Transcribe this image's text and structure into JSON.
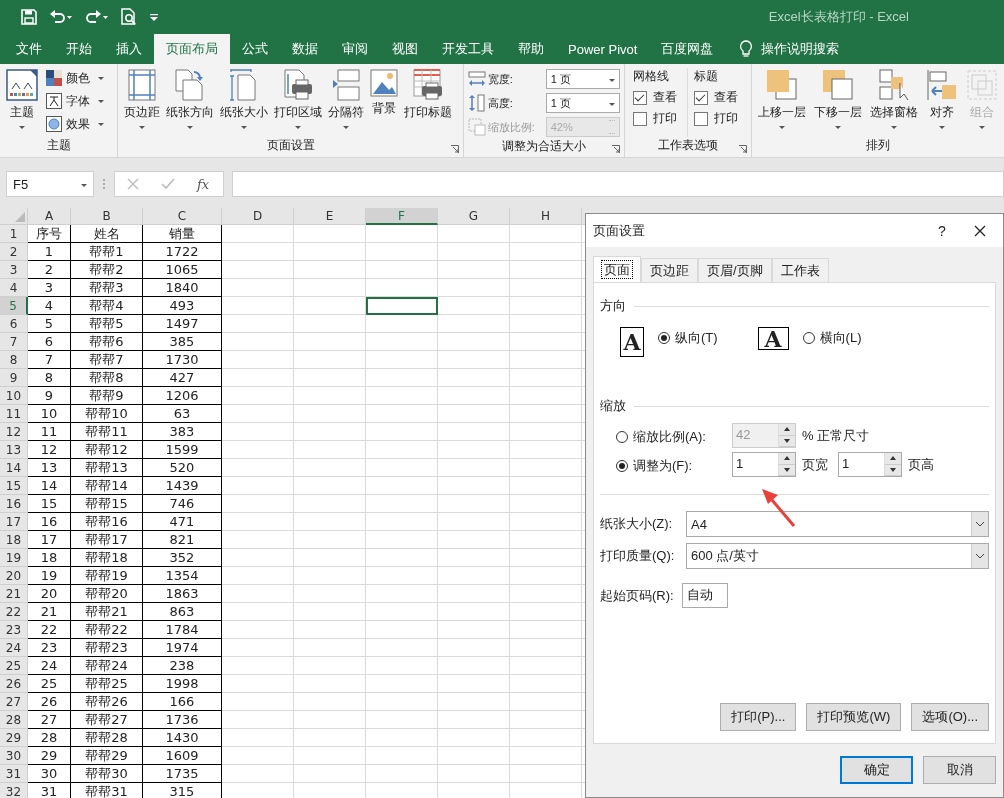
{
  "window": {
    "title": "Excel长表格打印  -  Excel"
  },
  "ribbon_tabs": [
    {
      "label": "文件",
      "selected": false
    },
    {
      "label": "开始",
      "selected": false
    },
    {
      "label": "插入",
      "selected": false
    },
    {
      "label": "页面布局",
      "selected": true
    },
    {
      "label": "公式",
      "selected": false
    },
    {
      "label": "数据",
      "selected": false
    },
    {
      "label": "审阅",
      "selected": false
    },
    {
      "label": "视图",
      "selected": false
    },
    {
      "label": "开发工具",
      "selected": false
    },
    {
      "label": "帮助",
      "selected": false
    },
    {
      "label": "Power Pivot",
      "selected": false
    },
    {
      "label": "百度网盘",
      "selected": false
    }
  ],
  "tell_me": "操作说明搜索",
  "ribbon": {
    "themes": {
      "label": "主题",
      "button": "主题",
      "items": [
        "颜色",
        "字体",
        "效果"
      ]
    },
    "page_setup": {
      "label": "页面设置",
      "buttons": [
        {
          "label": "页边距",
          "kind": "margins"
        },
        {
          "label": "纸张方向",
          "kind": "orientation"
        },
        {
          "label": "纸张大小",
          "kind": "size"
        },
        {
          "label": "打印区域",
          "kind": "area"
        },
        {
          "label": "分隔符",
          "kind": "breaks"
        },
        {
          "label": "背景",
          "kind": "background"
        },
        {
          "label": "打印标题",
          "kind": "titles"
        }
      ]
    },
    "scale_to_fit": {
      "label": "调整为合适大小",
      "fields": [
        {
          "label": "宽度:",
          "value": "1 页",
          "disabled": false
        },
        {
          "label": "高度:",
          "value": "1 页",
          "disabled": false
        },
        {
          "label": "缩放比例:",
          "value": "42%",
          "disabled": true
        }
      ]
    },
    "sheet_options": {
      "label": "工作表选项",
      "columns": [
        {
          "title": "网格线",
          "options": [
            {
              "label": "查看",
              "checked": true
            },
            {
              "label": "打印",
              "checked": false
            }
          ]
        },
        {
          "title": "标题",
          "options": [
            {
              "label": "查看",
              "checked": true
            },
            {
              "label": "打印",
              "checked": false
            }
          ]
        }
      ]
    },
    "arrange": {
      "label": "排列",
      "buttons": [
        {
          "label": "上移一层",
          "kind": "forward",
          "disabled": false
        },
        {
          "label": "下移一层",
          "kind": "backward",
          "disabled": false
        },
        {
          "label": "选择窗格",
          "kind": "pane",
          "disabled": false
        },
        {
          "label": "对齐",
          "kind": "align",
          "disabled": false
        },
        {
          "label": "组合",
          "kind": "group",
          "disabled": true
        }
      ]
    }
  },
  "formula_bar": {
    "name_box": "F5",
    "function_label": "fx"
  },
  "sheet": {
    "columns": [
      {
        "label": "A",
        "selected": false
      },
      {
        "label": "B",
        "selected": false
      },
      {
        "label": "C",
        "selected": false
      },
      {
        "label": "D",
        "selected": false
      },
      {
        "label": "E",
        "selected": false
      },
      {
        "label": "F",
        "selected": true
      },
      {
        "label": "G",
        "selected": false
      },
      {
        "label": "H",
        "selected": false
      }
    ],
    "rows": [
      {
        "num": "1",
        "selected": false,
        "cells": [
          "序号",
          "姓名",
          "销量"
        ]
      },
      {
        "num": "2",
        "selected": false,
        "cells": [
          "1",
          "帮帮1",
          "1722"
        ]
      },
      {
        "num": "3",
        "selected": false,
        "cells": [
          "2",
          "帮帮2",
          "1065"
        ]
      },
      {
        "num": "4",
        "selected": false,
        "cells": [
          "3",
          "帮帮3",
          "1840"
        ]
      },
      {
        "num": "5",
        "selected": true,
        "cells": [
          "4",
          "帮帮4",
          "493"
        ]
      },
      {
        "num": "6",
        "selected": false,
        "cells": [
          "5",
          "帮帮5",
          "1497"
        ]
      },
      {
        "num": "7",
        "selected": false,
        "cells": [
          "6",
          "帮帮6",
          "385"
        ]
      },
      {
        "num": "8",
        "selected": false,
        "cells": [
          "7",
          "帮帮7",
          "1730"
        ]
      },
      {
        "num": "9",
        "selected": false,
        "cells": [
          "8",
          "帮帮8",
          "427"
        ]
      },
      {
        "num": "10",
        "selected": false,
        "cells": [
          "9",
          "帮帮9",
          "1206"
        ]
      },
      {
        "num": "11",
        "selected": false,
        "cells": [
          "10",
          "帮帮10",
          "63"
        ]
      },
      {
        "num": "12",
        "selected": false,
        "cells": [
          "11",
          "帮帮11",
          "383"
        ]
      },
      {
        "num": "13",
        "selected": false,
        "cells": [
          "12",
          "帮帮12",
          "1599"
        ]
      },
      {
        "num": "14",
        "selected": false,
        "cells": [
          "13",
          "帮帮13",
          "520"
        ]
      },
      {
        "num": "15",
        "selected": false,
        "cells": [
          "14",
          "帮帮14",
          "1439"
        ]
      },
      {
        "num": "16",
        "selected": false,
        "cells": [
          "15",
          "帮帮15",
          "746"
        ]
      },
      {
        "num": "17",
        "selected": false,
        "cells": [
          "16",
          "帮帮16",
          "471"
        ]
      },
      {
        "num": "18",
        "selected": false,
        "cells": [
          "17",
          "帮帮17",
          "821"
        ]
      },
      {
        "num": "19",
        "selected": false,
        "cells": [
          "18",
          "帮帮18",
          "352"
        ]
      },
      {
        "num": "20",
        "selected": false,
        "cells": [
          "19",
          "帮帮19",
          "1354"
        ]
      },
      {
        "num": "21",
        "selected": false,
        "cells": [
          "20",
          "帮帮20",
          "1863"
        ]
      },
      {
        "num": "22",
        "selected": false,
        "cells": [
          "21",
          "帮帮21",
          "863"
        ]
      },
      {
        "num": "23",
        "selected": false,
        "cells": [
          "22",
          "帮帮22",
          "1784"
        ]
      },
      {
        "num": "24",
        "selected": false,
        "cells": [
          "23",
          "帮帮23",
          "1974"
        ]
      },
      {
        "num": "25",
        "selected": false,
        "cells": [
          "24",
          "帮帮24",
          "238"
        ]
      },
      {
        "num": "26",
        "selected": false,
        "cells": [
          "25",
          "帮帮25",
          "1998"
        ]
      },
      {
        "num": "27",
        "selected": false,
        "cells": [
          "26",
          "帮帮26",
          "166"
        ]
      },
      {
        "num": "28",
        "selected": false,
        "cells": [
          "27",
          "帮帮27",
          "1736"
        ]
      },
      {
        "num": "29",
        "selected": false,
        "cells": [
          "28",
          "帮帮28",
          "1430"
        ]
      },
      {
        "num": "30",
        "selected": false,
        "cells": [
          "29",
          "帮帮29",
          "1609"
        ]
      },
      {
        "num": "31",
        "selected": false,
        "cells": [
          "30",
          "帮帮30",
          "1735"
        ]
      },
      {
        "num": "32",
        "selected": false,
        "cells": [
          "31",
          "帮帮31",
          "315"
        ]
      }
    ]
  },
  "dialog": {
    "title": "页面设置",
    "help": "?",
    "tabs": [
      {
        "label": "页面",
        "selected": true
      },
      {
        "label": "页边距",
        "selected": false
      },
      {
        "label": "页眉/页脚",
        "selected": false
      },
      {
        "label": "工作表",
        "selected": false
      }
    ],
    "orientation": {
      "title": "方向",
      "options": [
        {
          "label": "纵向(T)",
          "glyph": "A",
          "kind": "portrait",
          "selected": true
        },
        {
          "label": "横向(L)",
          "glyph": "A",
          "kind": "landscape",
          "selected": false
        }
      ]
    },
    "scaling": {
      "title": "缩放",
      "adjust": {
        "label": "缩放比例(A):",
        "value": "42",
        "suffix": "% 正常尺寸",
        "selected": false,
        "disabled": true
      },
      "fit": {
        "label": "调整为(F):",
        "wide": "1",
        "wide_label": "页宽",
        "tall": "1",
        "tall_label": "页高",
        "selected": true
      }
    },
    "selects": [
      {
        "label": "纸张大小(Z):",
        "value": "A4"
      },
      {
        "label": "打印质量(Q):",
        "value": "600 点/英寸"
      }
    ],
    "first_page": {
      "label": "起始页码(R):",
      "value": "自动"
    },
    "buttons": [
      "打印(P)...",
      "打印预览(W)",
      "选项(O)..."
    ],
    "footer_buttons": [
      {
        "label": "确定",
        "default": true
      },
      {
        "label": "取消",
        "default": false
      }
    ]
  }
}
